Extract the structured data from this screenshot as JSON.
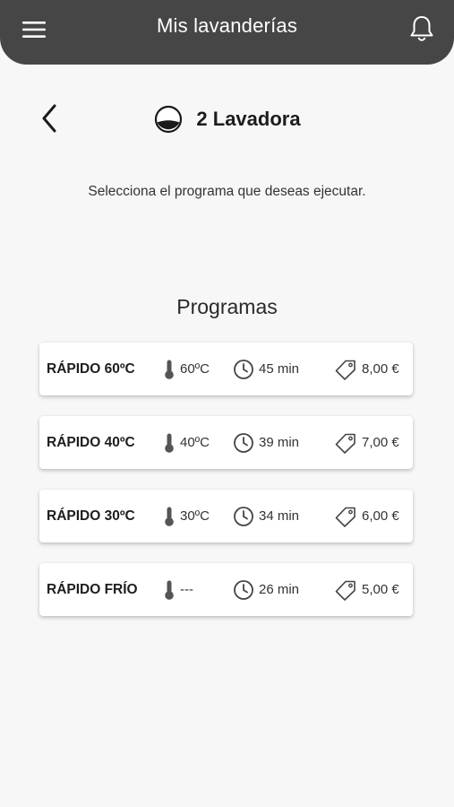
{
  "header": {
    "title": "Mis lavanderías",
    "menu_icon": "hamburger-menu-icon",
    "bell_icon": "bell-icon",
    "background": "#464646"
  },
  "machine": {
    "name": "2 Lavadora",
    "icon": "washer-drum-icon"
  },
  "instruction": "Selecciona el programa que deseas ejecutar.",
  "programs_section": {
    "title": "Programas",
    "items": [
      {
        "name": "RÁPIDO 60ºC",
        "temperature": "60ºC",
        "duration": "45 min",
        "price": "8,00 €"
      },
      {
        "name": "RÁPIDO 40ºC",
        "temperature": "40ºC",
        "duration": "39 min",
        "price": "7,00 €"
      },
      {
        "name": "RÁPIDO 30ºC",
        "temperature": "30ºC",
        "duration": "34 min",
        "price": "6,00 €"
      },
      {
        "name": "RÁPIDO FRÍO",
        "temperature": "---",
        "duration": "26 min",
        "price": "5,00 €"
      }
    ]
  }
}
